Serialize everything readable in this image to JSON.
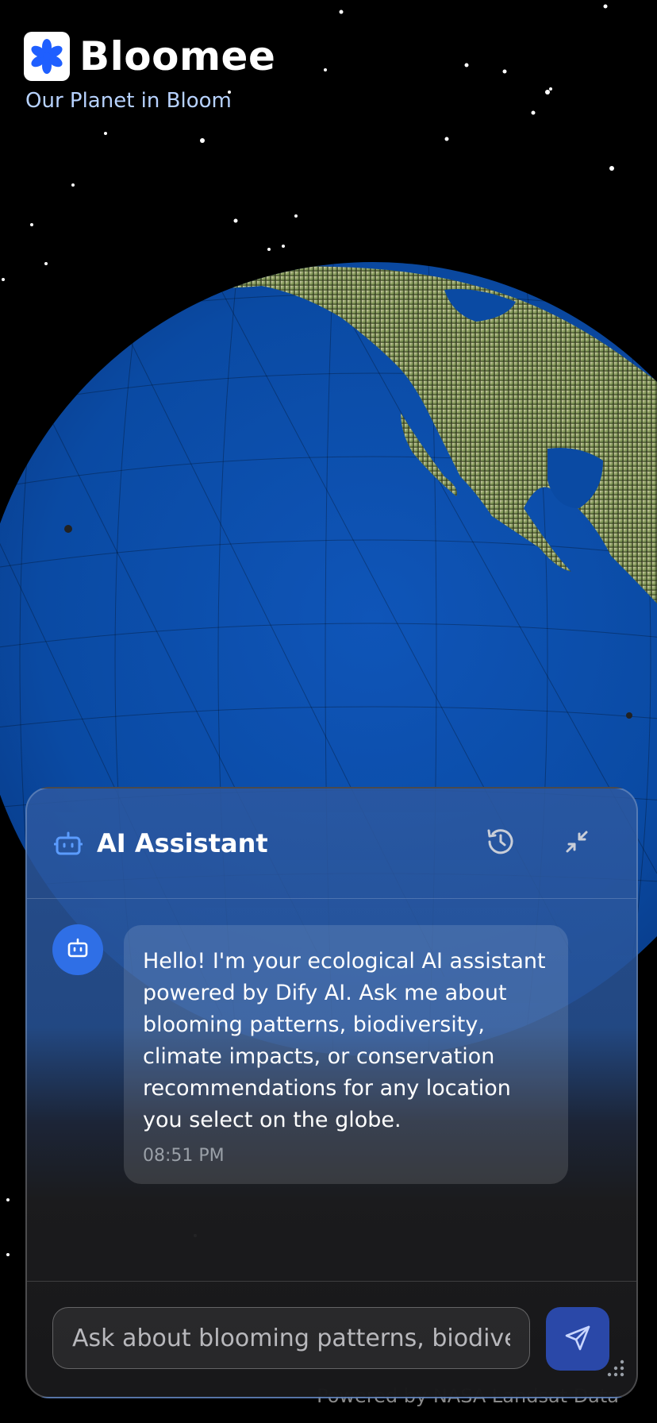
{
  "brand": {
    "name": "Bloomee",
    "tagline": "Our Planet in Bloom",
    "logo_icon": "flower-asterisk-icon",
    "logo_color": "#1f5fff"
  },
  "footer": {
    "credit": "Powered by NASA Landsat Data"
  },
  "chat": {
    "title": "AI Assistant",
    "header_icons": [
      "robot-icon",
      "history-icon",
      "minimize-icon"
    ],
    "messages": [
      {
        "sender": "assistant",
        "avatar_icon": "robot-icon",
        "text": "Hello! I'm your ecological AI assistant powered by Dify AI. Ask me about blooming patterns, biodiversity, climate impacts, or conservation recommendations for any location you select on the globe.",
        "time": "08:51 PM"
      }
    ],
    "input": {
      "placeholder": "Ask about blooming patterns, biodiversity...",
      "value": ""
    },
    "send_icon": "send-icon",
    "accent_color": "#2f6fe6"
  },
  "globe": {
    "ocean_color": "#0b4aa6",
    "visible_region": "North America"
  }
}
